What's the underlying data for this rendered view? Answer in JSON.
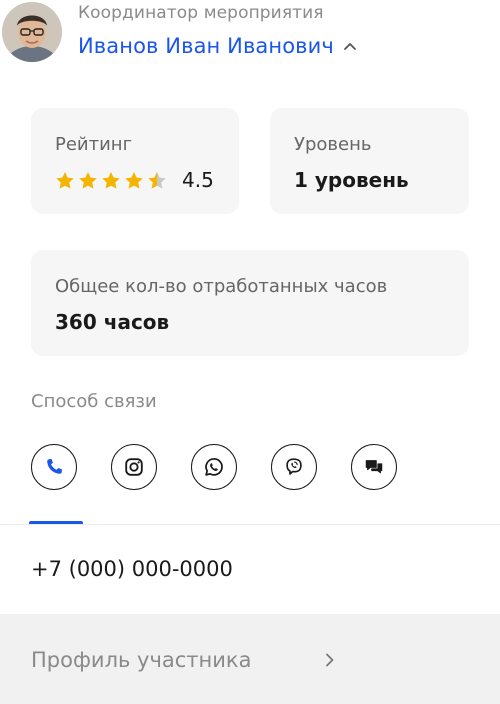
{
  "header": {
    "role": "Координатор мероприятия",
    "name": "Иванов Иван Иванович",
    "avatar_icon": "person-avatar",
    "expand_icon": "chevron-up-icon"
  },
  "stats": {
    "rating": {
      "label": "Рейтинг",
      "value": "4.5",
      "stars_total": 5,
      "stars_filled": 4.5,
      "star_color": "#f4b400",
      "star_empty_color": "#c8c8c8"
    },
    "level": {
      "label": "Уровень",
      "value": "1 уровень"
    },
    "hours": {
      "label": "Общее кол-во отработанных часов",
      "value": "360 часов"
    }
  },
  "contact": {
    "title": "Способ связи",
    "methods": [
      {
        "icon": "phone-icon",
        "active": true
      },
      {
        "icon": "instagram-icon",
        "active": false
      },
      {
        "icon": "whatsapp-icon",
        "active": false
      },
      {
        "icon": "viber-icon",
        "active": false
      },
      {
        "icon": "chat-icon",
        "active": false
      }
    ],
    "active_value": "+7 (000) 000-0000"
  },
  "footer": {
    "profile_label": "Профиль участника",
    "icon": "chevron-right-icon"
  },
  "colors": {
    "accent": "#1a56e8",
    "card_bg": "#f6f6f6",
    "footer_bg": "#f1f1f1"
  }
}
